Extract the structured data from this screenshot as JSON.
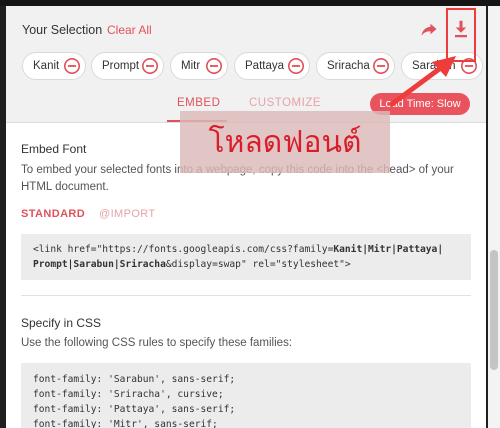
{
  "header": {
    "selection_title": "Your Selection",
    "clear_all_label": "Clear All",
    "share_icon": "share-icon",
    "download_icon": "download-icon"
  },
  "fonts": [
    {
      "name": "Kanit"
    },
    {
      "name": "Prompt"
    },
    {
      "name": "Mitr"
    },
    {
      "name": "Pattaya"
    },
    {
      "name": "Sriracha"
    },
    {
      "name": "Sarabun"
    }
  ],
  "tabs": {
    "embed_label": "EMBED",
    "customize_label": "CUSTOMIZE",
    "active": "EMBED"
  },
  "load_time_label": "Load Time: Slow",
  "embed": {
    "section_title": "Embed Font",
    "description": "To embed your selected fonts into a webpage, copy this code into the <head> of your HTML document.",
    "standard_label": "STANDARD",
    "import_label": "@IMPORT",
    "code_line1_prefix": "<link href=\"https://fonts.googleapis.com/css?family=",
    "code_line1_fonts": "Kanit|Mitr|Pattaya|",
    "code_line2_fonts": "Prompt|Sarabun|Sriracha",
    "code_line2_suffix": "&display=swap\" rel=\"stylesheet\">"
  },
  "css": {
    "section_title": "Specify in CSS",
    "description": "Use the following CSS rules to specify these families:",
    "rules": [
      "font-family: 'Sarabun', sans-serif;",
      "font-family: 'Sriracha', cursive;",
      "font-family: 'Pattaya', sans-serif;",
      "font-family: 'Mitr', sans-serif;"
    ]
  },
  "annotation": {
    "overlay_text": "โหลดฟอนต์",
    "accent_color": "#e0525b",
    "highlight_color": "#ee3b3b"
  }
}
